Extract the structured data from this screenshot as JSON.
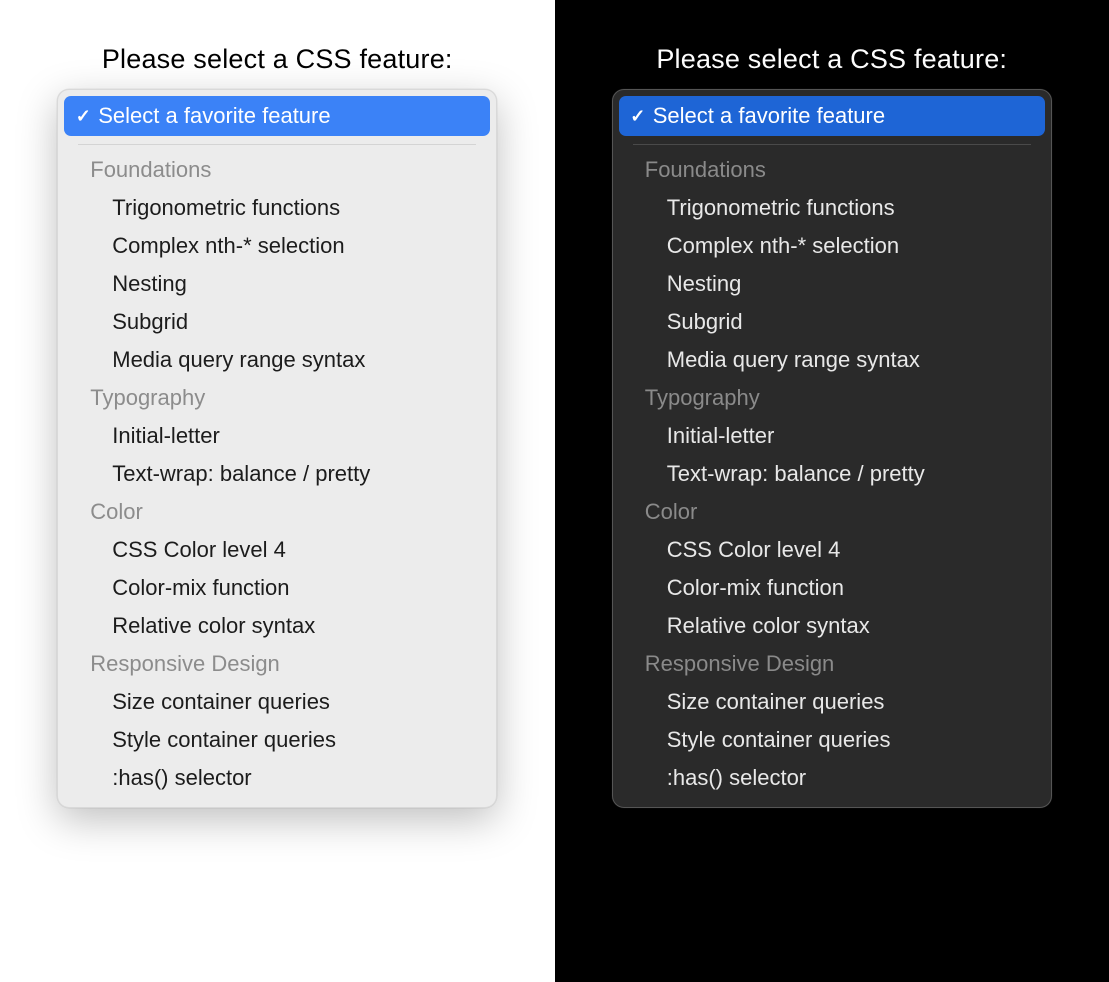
{
  "prompt": "Please select a CSS feature:",
  "selected_label": "Select a favorite feature",
  "colors": {
    "light_accent": "#3b82f7",
    "dark_accent": "#1e65d6"
  },
  "groups": [
    {
      "label": "Foundations",
      "options": [
        "Trigonometric functions",
        "Complex nth-* selection",
        "Nesting",
        "Subgrid",
        "Media query range syntax"
      ]
    },
    {
      "label": "Typography",
      "options": [
        "Initial-letter",
        "Text-wrap: balance / pretty"
      ]
    },
    {
      "label": "Color",
      "options": [
        "CSS Color level 4",
        "Color-mix function",
        "Relative color syntax"
      ]
    },
    {
      "label": "Responsive Design",
      "options": [
        "Size container queries",
        "Style container queries",
        ":has() selector"
      ]
    }
  ]
}
